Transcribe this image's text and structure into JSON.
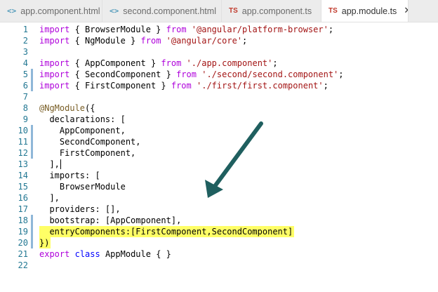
{
  "tabs": [
    {
      "label": "app.component.html",
      "icon": "html-file-icon",
      "icon_glyph": "<>",
      "active": false
    },
    {
      "label": "second.component.html",
      "icon": "html-file-icon",
      "icon_glyph": "<>",
      "active": false
    },
    {
      "label": "app.component.ts",
      "icon": "typescript-file-icon",
      "icon_glyph": "TS",
      "active": false
    },
    {
      "label": "app.module.ts",
      "icon": "typescript-file-icon",
      "icon_glyph": "TS",
      "active": true
    }
  ],
  "close_glyph": "✕",
  "colors": {
    "keyword": "#0000ff",
    "import_keyword": "#af00db",
    "string": "#a31515",
    "line_number": "#237893",
    "highlight": "#ffff33",
    "arrow": "#1f5f5f"
  },
  "code_lines": [
    {
      "n": "1",
      "text": "import { BrowserModule } from '@angular/platform-browser';"
    },
    {
      "n": "2",
      "text": "import { NgModule } from '@angular/core';"
    },
    {
      "n": "3",
      "text": ""
    },
    {
      "n": "4",
      "text": "import { AppComponent } from './app.component';"
    },
    {
      "n": "5",
      "text": "import { SecondComponent } from './second/second.component';"
    },
    {
      "n": "6",
      "text": "import { FirstComponent } from './first/first.component';"
    },
    {
      "n": "7",
      "text": ""
    },
    {
      "n": "8",
      "text": "@NgModule({"
    },
    {
      "n": "9",
      "text": "  declarations: ["
    },
    {
      "n": "10",
      "text": "    AppComponent,"
    },
    {
      "n": "11",
      "text": "    SecondComponent,"
    },
    {
      "n": "12",
      "text": "    FirstComponent,"
    },
    {
      "n": "13",
      "text": "  ],"
    },
    {
      "n": "14",
      "text": "  imports: ["
    },
    {
      "n": "15",
      "text": "    BrowserModule"
    },
    {
      "n": "16",
      "text": "  ],"
    },
    {
      "n": "17",
      "text": "  providers: [],"
    },
    {
      "n": "18",
      "text": "  bootstrap: [AppComponent],"
    },
    {
      "n": "19",
      "text": "  entryComponents:[FirstComponent,SecondComponent]"
    },
    {
      "n": "20",
      "text": "})"
    },
    {
      "n": "21",
      "text": "export class AppModule { }"
    },
    {
      "n": "22",
      "text": ""
    }
  ],
  "modified_lines": [
    "5",
    "6",
    "10",
    "11",
    "12",
    "18",
    "19",
    "20"
  ],
  "highlighted_lines": [
    "19",
    "20"
  ],
  "cursor_line": "13"
}
